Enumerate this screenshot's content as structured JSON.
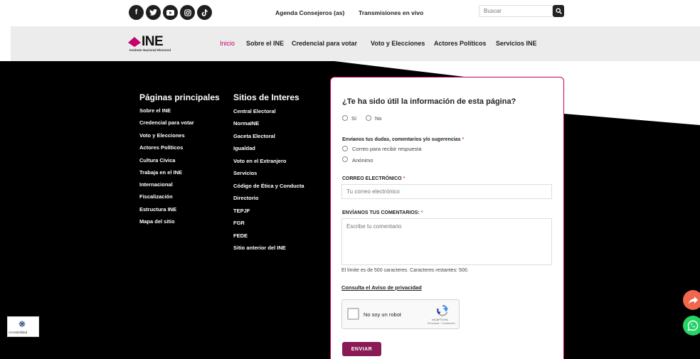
{
  "header": {
    "social_icons": [
      "facebook-icon",
      "twitter-icon",
      "youtube-icon",
      "instagram-icon",
      "tiktok-icon"
    ],
    "links": [
      "Agenda Consejeros (as)",
      "Transmisiones en vivo"
    ],
    "search_placeholder": "Buscar"
  },
  "brand": {
    "name": "INE",
    "subtitle": "Instituto Nacional Electoral",
    "accent": "#c4006d"
  },
  "nav": {
    "items": [
      "Inicio",
      "Sobre el INE",
      "Credencial para votar",
      "Voto y Elecciones",
      "Actores Políticos",
      "Servicios INE"
    ],
    "active": "Inicio"
  },
  "footer": {
    "col1": {
      "title": "Páginas principales",
      "links": [
        "Sobre el INE",
        "Credencial para votar",
        "Voto y Elecciones",
        "Actores Políticos",
        "Cultura Cívica",
        "Trabaja en el INE",
        "Internacional",
        "Fiscalización",
        "Estructura INE",
        "Mapa del sitio"
      ]
    },
    "col2": {
      "title": "Sitios de Interes",
      "links": [
        "Central Electoral",
        "NormaINE",
        "Gaceta Electoral",
        "Igualdad",
        "Voto en el Extranjero",
        "Servicios",
        "Código de Ética y Conducta",
        "Directorio",
        "TEPJF",
        "FGR",
        "FEDE",
        "Sitio anterior del INE"
      ]
    }
  },
  "form": {
    "question": "¿Te ha sido útil la información de esta página?",
    "yes": "Sí",
    "no": "No",
    "doubts_label": "Envíanos tus dudas, comentarios y/o sugerencias",
    "required_mark": "*",
    "option_email": "Correo para recibir respuesta",
    "option_anon": "Anónimo",
    "email_label": "CORREO ELECTRÓNICO",
    "email_placeholder": "Tu correo electrónico",
    "comments_label": "ENVÍANOS TUS COMENTARIOS:",
    "comments_placeholder": "Escribe tu comentario",
    "limit_text": "El límite es de 500 caracteres. Caracteres restantes: 500.",
    "privacy_link": "Consulta el Aviso de privacidad",
    "captcha_text": "No soy un robot",
    "captcha_brand": "reCAPTCHA",
    "captcha_links": "Privacidad - Condiciones",
    "submit": "ENVIAR"
  },
  "accessibility_label": "Accesibilidad"
}
